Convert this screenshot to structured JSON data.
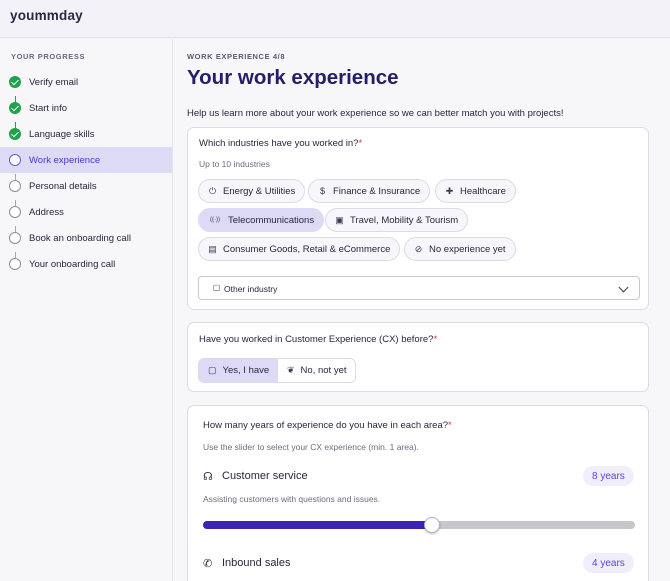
{
  "app": {
    "logo": "yoummday"
  },
  "sidebar": {
    "heading": "YOUR PROGRESS",
    "steps": [
      {
        "label": "Verify email",
        "state": "done"
      },
      {
        "label": "Start info",
        "state": "done"
      },
      {
        "label": "Language skills",
        "state": "done"
      },
      {
        "label": "Work experience",
        "state": "current"
      },
      {
        "label": "Personal details",
        "state": "todo"
      },
      {
        "label": "Address",
        "state": "todo"
      },
      {
        "label": "Book an onboarding call",
        "state": "todo"
      },
      {
        "label": "Your onboarding call",
        "state": "todo"
      }
    ]
  },
  "page": {
    "eyebrow": "WORK EXPERIENCE 4/8",
    "title": "Your work experience",
    "intro": "Help us learn more about your work experience so we can better match you with projects!"
  },
  "industries": {
    "question": "Which industries have you worked in?",
    "required_mark": "*",
    "hint": "Up to 10 industries",
    "chips": [
      {
        "label": "Energy & Utilities",
        "icon": "power-icon",
        "glyph": "⏻",
        "selected": false
      },
      {
        "label": "Finance & Insurance",
        "icon": "dollar-icon",
        "glyph": "$",
        "selected": false
      },
      {
        "label": "Healthcare",
        "icon": "healthcare-icon",
        "glyph": "✚",
        "selected": false
      },
      {
        "label": "Telecommunications",
        "icon": "antenna-icon",
        "glyph": "((·))",
        "selected": true
      },
      {
        "label": "Travel, Mobility & Tourism",
        "icon": "luggage-icon",
        "glyph": "▣",
        "selected": false
      },
      {
        "label": "Consumer Goods, Retail & eCommerce",
        "icon": "store-icon",
        "glyph": "▤",
        "selected": false
      },
      {
        "label": "No experience yet",
        "icon": "no-experience-icon",
        "glyph": "⊘",
        "selected": false
      }
    ],
    "other_select": {
      "label": "Other industry",
      "icon": "briefcase-icon",
      "glyph": "▢"
    }
  },
  "cx": {
    "question": "Have you worked in Customer Experience (CX) before?",
    "required_mark": "*",
    "options": [
      {
        "label": "Yes, I have",
        "icon": "briefcase-icon",
        "glyph": "▢",
        "selected": true
      },
      {
        "label": "No, not yet",
        "icon": "sprout-icon",
        "glyph": "❦",
        "selected": false
      }
    ]
  },
  "years": {
    "question": "How many years of experience do you have in each area?",
    "required_mark": "*",
    "hint": "Use the slider to select your CX experience (min. 1 area).",
    "areas": [
      {
        "name": "Customer service",
        "icon": "headset-icon",
        "glyph": "☊",
        "badge": "8 years",
        "description": "Assisting customers with questions and issues.",
        "slider_fraction": 0.53
      },
      {
        "name": "Inbound sales",
        "icon": "phone-incoming-icon",
        "glyph": "✆",
        "badge": "4 years"
      }
    ]
  },
  "colors": {
    "accent": "#4a38c9",
    "title": "#241e6a",
    "success": "#1fa34a",
    "required": "#d93240",
    "slider_fill": "#3b22b8"
  }
}
